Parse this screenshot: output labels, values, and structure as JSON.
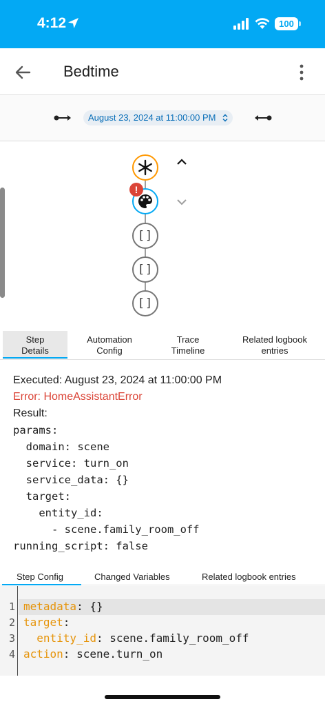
{
  "status": {
    "time": "4:12",
    "battery": "100"
  },
  "header": {
    "title": "Bedtime"
  },
  "trace_nav": {
    "selected_run": "August 23, 2024 at 11:00:00 PM"
  },
  "tabs": {
    "step_details": "Step\nDetails",
    "automation_config": "Automation\nConfig",
    "trace_timeline": "Trace\nTimeline",
    "related_logbook": "Related logbook\nentries"
  },
  "details": {
    "executed": "Executed: August 23, 2024 at 11:00:00 PM",
    "error": "Error: HomeAssistantError",
    "result": "Result:",
    "yaml": [
      "params:",
      "  domain: scene",
      "  service: turn_on",
      "  service_data: {}",
      "  target:",
      "    entity_id:",
      "      - scene.family_room_off",
      "running_script: false"
    ]
  },
  "sub_tabs": {
    "step_config": "Step Config",
    "changed_variables": "Changed Variables",
    "related_logbook": "Related logbook entries"
  },
  "editor": {
    "lines": [
      {
        "num": "1",
        "key": "metadata",
        "rest": ": {}"
      },
      {
        "num": "2",
        "key": "target",
        "rest": ":"
      },
      {
        "num": "3",
        "key": "  entity_id",
        "rest": ": scene.family_room_off"
      },
      {
        "num": "4",
        "key": "action",
        "rest": ": scene.turn_on"
      }
    ]
  },
  "colors": {
    "accent": "#03a9f4",
    "trigger": "#ff9800",
    "error": "#db4437",
    "yaml_key": "#e6940a"
  },
  "icons": [
    "location-arrow-icon",
    "signal-icon",
    "wifi-icon",
    "back-arrow-icon",
    "more-vert-icon",
    "trigger-asterisk-icon",
    "palette-icon",
    "error-icon",
    "chevron-up-icon",
    "chevron-down-icon"
  ]
}
